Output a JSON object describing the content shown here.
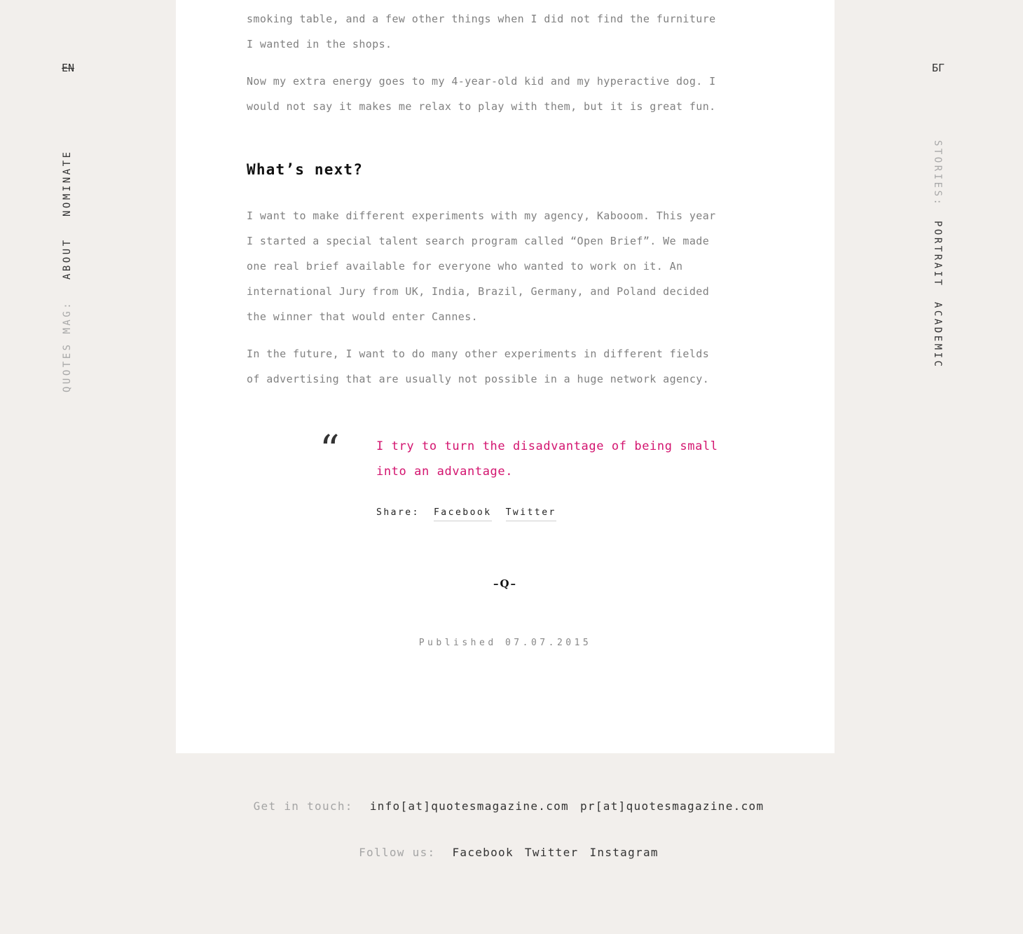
{
  "lang": {
    "current": "EN",
    "other": "БГ"
  },
  "left_nav": {
    "label": "QUOTES MAG:",
    "items": [
      "ABOUT",
      "NOMINATE"
    ]
  },
  "right_nav": {
    "label": "STORIES:",
    "items": [
      "PORTRAIT",
      "ACADEMIC"
    ]
  },
  "article": {
    "para_top_1": "smoking table, and a few other things when I did not find the furniture",
    "para_top_2": "I wanted in the shops.",
    "para_energy_1": "Now my extra energy goes to my 4-year-old kid and my hyperactive dog. I",
    "para_energy_2": "would not say it makes me relax to play with them, but it is great fun.",
    "heading": "What’s next?",
    "para_next": [
      "I want to make different experiments with my agency, Kabooom. This year",
      "I started a special talent search program called “Open Brief”. We made",
      "one real brief available for everyone who wanted to work on it. An",
      "international Jury from UK, India, Brazil, Germany, and Poland decided",
      "the winner that would enter Cannes."
    ],
    "para_future": [
      "In the future, I want to do many other experiments in different fields",
      "of advertising that are usually not possible in a huge network agency."
    ],
    "quote_mark": "“",
    "quote": [
      "I try to turn the disadvantage of being small",
      "into an advantage."
    ],
    "share_label": "Share:",
    "share_facebook": "Facebook",
    "share_twitter": "Twitter",
    "ornament": "–Q–",
    "published": "Published 07.07.2015"
  },
  "footer": {
    "contact_label": "Get in touch:",
    "email_info": "info[at]quotesmagazine.com",
    "email_pr": "pr[at]quotesmagazine.com",
    "follow_label": "Follow us:",
    "social": [
      "Facebook",
      "Twitter",
      "Instagram"
    ]
  },
  "colors": {
    "accent": "#d3146f",
    "background": "#f2efec",
    "card": "#ffffff"
  }
}
